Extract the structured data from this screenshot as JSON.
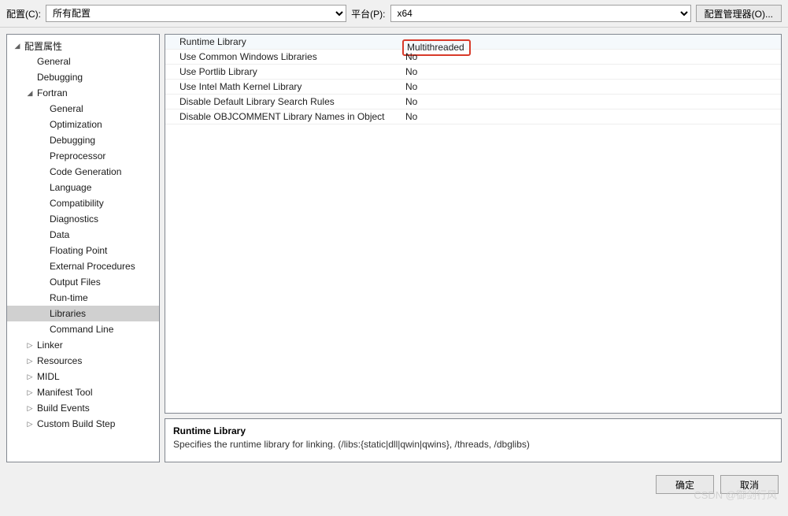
{
  "topbar": {
    "config_label": "配置(C):",
    "config_value": "所有配置",
    "platform_label": "平台(P):",
    "platform_value": "x64",
    "manager_button": "配置管理器(O)..."
  },
  "tree": {
    "root": "配置属性",
    "items_l2": [
      {
        "label": "General",
        "expand": ""
      },
      {
        "label": "Debugging",
        "expand": ""
      },
      {
        "label": "Fortran",
        "expand": "open",
        "children": [
          "General",
          "Optimization",
          "Debugging",
          "Preprocessor",
          "Code Generation",
          "Language",
          "Compatibility",
          "Diagnostics",
          "Data",
          "Floating Point",
          "External Procedures",
          "Output Files",
          "Run-time",
          "Libraries",
          "Command Line"
        ]
      },
      {
        "label": "Linker",
        "expand": "closed"
      },
      {
        "label": "Resources",
        "expand": "closed"
      },
      {
        "label": "MIDL",
        "expand": "closed"
      },
      {
        "label": "Manifest Tool",
        "expand": "closed"
      },
      {
        "label": "Build Events",
        "expand": "closed"
      },
      {
        "label": "Custom Build Step",
        "expand": "closed"
      }
    ],
    "selected_l3": "Libraries"
  },
  "grid": [
    {
      "label": "Runtime Library",
      "value": "Multithreaded",
      "highlight": true
    },
    {
      "label": "Use Common Windows Libraries",
      "value": "No"
    },
    {
      "label": "Use Portlib Library",
      "value": "No"
    },
    {
      "label": "Use Intel Math Kernel Library",
      "value": "No"
    },
    {
      "label": "Disable Default Library Search Rules",
      "value": "No"
    },
    {
      "label": "Disable OBJCOMMENT Library Names in Object",
      "value": "No"
    }
  ],
  "description": {
    "title": "Runtime Library",
    "text": "Specifies the runtime library for linking. (/libs:{static|dll|qwin|qwins}, /threads, /dbglibs)"
  },
  "footer": {
    "ok": "确定",
    "cancel": "取消"
  },
  "watermark": "CSDN @御剑行风"
}
